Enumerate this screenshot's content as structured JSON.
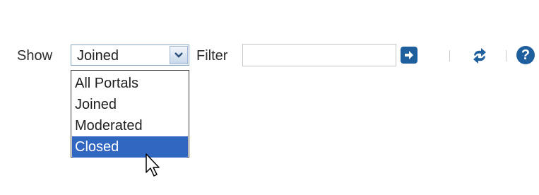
{
  "toolbar": {
    "show_label": "Show",
    "show_select": {
      "value": "Joined",
      "options": [
        "All Portals",
        "Joined",
        "Moderated",
        "Closed"
      ],
      "highlighted": "Closed"
    },
    "filter_label": "Filter",
    "filter_input": {
      "value": "",
      "placeholder": ""
    },
    "go_icon": "arrow-right-icon",
    "refresh_icon": "refresh-icon",
    "help_icon": "help-icon",
    "help_glyph": "?"
  },
  "colors": {
    "accent": "#1f5f9e",
    "highlight": "#3167c1",
    "select_border": "#8aa6c5"
  },
  "cursor": "arrow-pointer"
}
